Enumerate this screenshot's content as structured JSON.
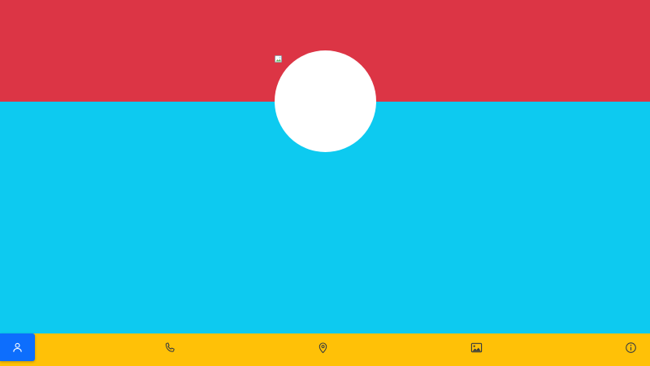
{
  "colors": {
    "top_band": "#dc3545",
    "main_area": "#0dcaf0",
    "avatar": "#ffffff",
    "bottom_nav": "#ffc107",
    "active_tab": "#0d6efd",
    "icon": "#343a40",
    "active_icon": "#ffffff"
  },
  "profile": {
    "avatar_icon": "broken-image-icon"
  },
  "bottom_nav": {
    "items": [
      {
        "icon": "person-icon",
        "active": true
      },
      {
        "icon": "phone-icon",
        "active": false
      },
      {
        "icon": "location-pin-icon",
        "active": false
      },
      {
        "icon": "image-icon",
        "active": false
      },
      {
        "icon": "info-icon",
        "active": false
      }
    ]
  }
}
